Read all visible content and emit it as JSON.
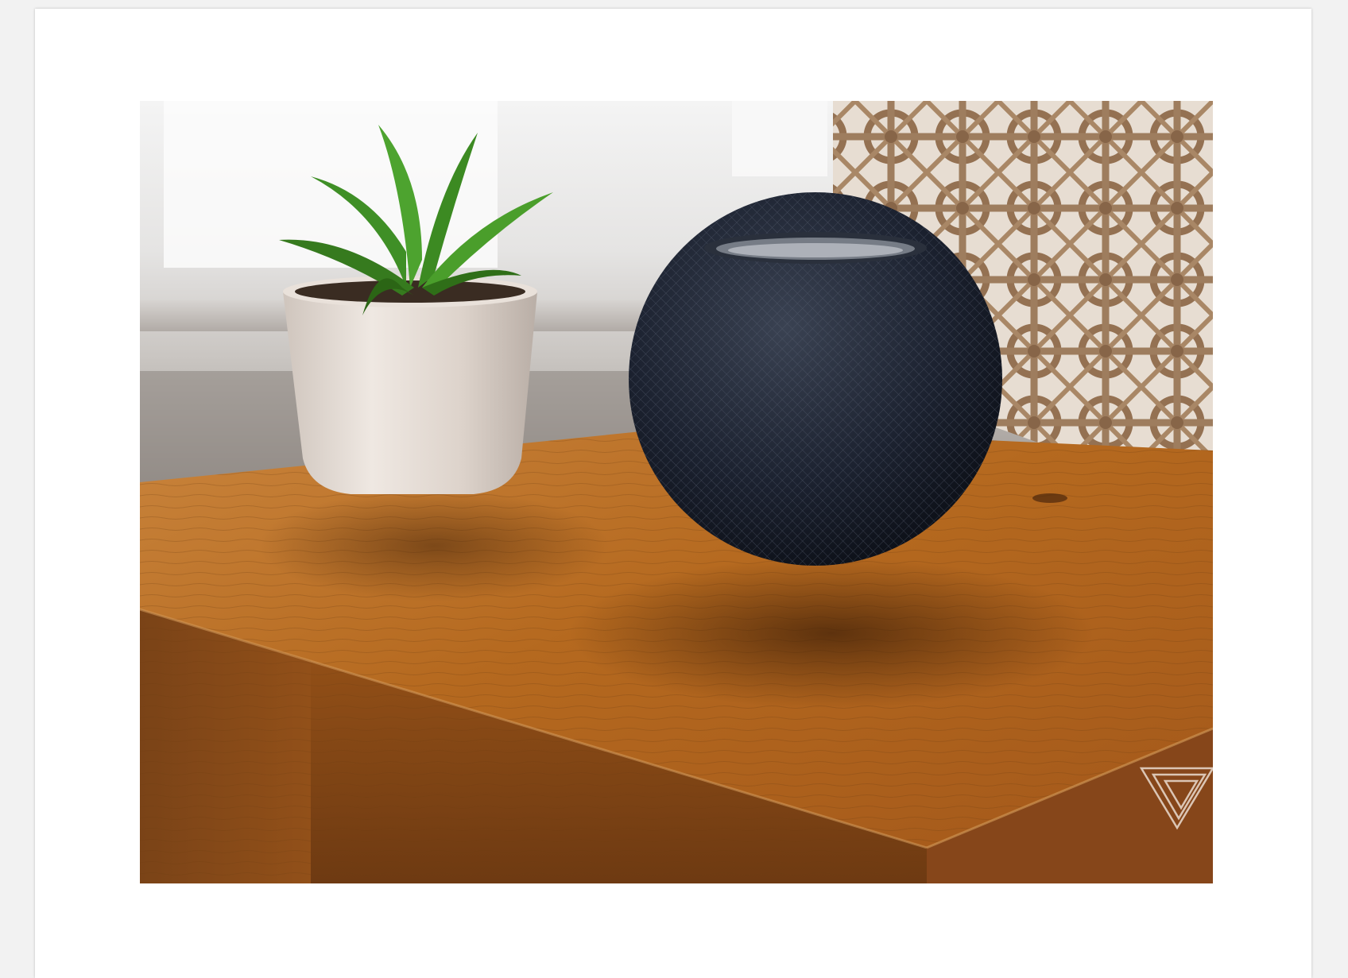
{
  "photo": {
    "subject_icons": [
      "speaker-icon",
      "potted-plant-icon",
      "lattice-panel-icon",
      "watermark-logo-icon"
    ],
    "colors": {
      "page_background": "#f2f2f2",
      "card_background": "#ffffff",
      "wood_top": "#b4661f",
      "wood_front": "#8a4a18",
      "speaker_mesh": "#1c2230",
      "pot": "#e6ddd6",
      "leaves": "#3f8f26",
      "wall": "#dcdad8",
      "lattice": "#9a7a5c"
    }
  }
}
